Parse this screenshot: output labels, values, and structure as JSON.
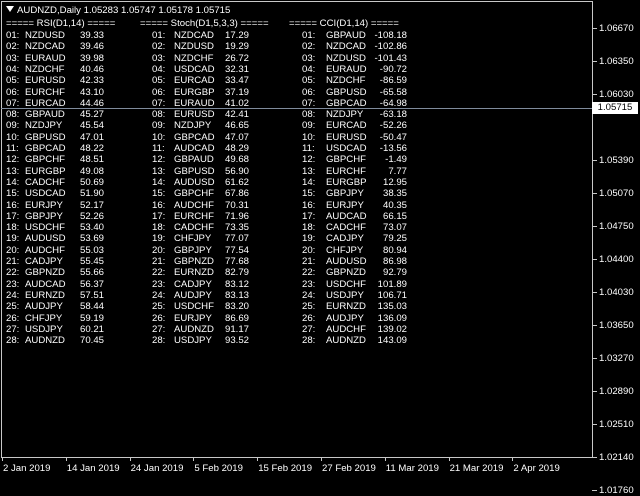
{
  "title": "AUDNZD,Daily  1.05283 1.05747 1.05178 1.05715",
  "current_price": "1.05715",
  "price_axis": [
    "1.06670",
    "1.06350",
    "1.06030",
    "1.05715",
    "1.05390",
    "1.05070",
    "1.04750",
    "1.04400",
    "1.04030",
    "1.03650",
    "1.03270",
    "1.02890",
    "1.02510",
    "1.02140",
    "1.01760"
  ],
  "time_axis": [
    "2 Jan 2019",
    "14 Jan 2019",
    "24 Jan 2019",
    "5 Feb 2019",
    "15 Feb 2019",
    "27 Feb 2019",
    "11 Mar 2019",
    "21 Mar 2019",
    "2 Apr 2019"
  ],
  "indicators": [
    {
      "header": "===== RSI(D1,14) =====",
      "rows": [
        [
          "01:",
          "NZDUSD",
          "39.33"
        ],
        [
          "02:",
          "NZDCAD",
          "39.46"
        ],
        [
          "03:",
          "EURAUD",
          "39.98"
        ],
        [
          "04:",
          "NZDCHF",
          "40.46"
        ],
        [
          "05:",
          "EURUSD",
          "42.33"
        ],
        [
          "06:",
          "EURCHF",
          "43.10"
        ],
        [
          "07:",
          "EURCAD",
          "44.46"
        ],
        [
          "08:",
          "GBPAUD",
          "45.27"
        ],
        [
          "09:",
          "NZDJPY",
          "45.54"
        ],
        [
          "10:",
          "GBPUSD",
          "47.01"
        ],
        [
          "11:",
          "GBPCAD",
          "48.22"
        ],
        [
          "12:",
          "GBPCHF",
          "48.51"
        ],
        [
          "13:",
          "EURGBP",
          "49.08"
        ],
        [
          "14:",
          "CADCHF",
          "50.69"
        ],
        [
          "15:",
          "USDCAD",
          "51.90"
        ],
        [
          "16:",
          "EURJPY",
          "52.17"
        ],
        [
          "17:",
          "GBPJPY",
          "52.26"
        ],
        [
          "18:",
          "USDCHF",
          "53.40"
        ],
        [
          "19:",
          "AUDUSD",
          "53.69"
        ],
        [
          "20:",
          "AUDCHF",
          "55.03"
        ],
        [
          "21:",
          "CADJPY",
          "55.45"
        ],
        [
          "22:",
          "GBPNZD",
          "55.66"
        ],
        [
          "23:",
          "AUDCAD",
          "56.37"
        ],
        [
          "24:",
          "EURNZD",
          "57.51"
        ],
        [
          "25:",
          "AUDJPY",
          "58.44"
        ],
        [
          "26:",
          "CHFJPY",
          "59.19"
        ],
        [
          "27:",
          "USDJPY",
          "60.21"
        ],
        [
          "28:",
          "AUDNZD",
          "70.45"
        ]
      ]
    },
    {
      "header": "===== Stoch(D1,5,3,3) =====",
      "rows": [
        [
          "01:",
          "NZDCAD",
          "17.29"
        ],
        [
          "02:",
          "NZDUSD",
          "19.29"
        ],
        [
          "03:",
          "NZDCHF",
          "26.72"
        ],
        [
          "04:",
          "USDCAD",
          "32.31"
        ],
        [
          "05:",
          "EURCAD",
          "33.47"
        ],
        [
          "06:",
          "EURGBP",
          "37.19"
        ],
        [
          "07:",
          "EURAUD",
          "41.02"
        ],
        [
          "08:",
          "EURUSD",
          "42.41"
        ],
        [
          "09:",
          "NZDJPY",
          "46.65"
        ],
        [
          "10:",
          "GBPCAD",
          "47.07"
        ],
        [
          "11:",
          "AUDCAD",
          "48.29"
        ],
        [
          "12:",
          "GBPAUD",
          "49.68"
        ],
        [
          "13:",
          "GBPUSD",
          "56.90"
        ],
        [
          "14:",
          "AUDUSD",
          "61.62"
        ],
        [
          "15:",
          "GBPCHF",
          "67.86"
        ],
        [
          "16:",
          "AUDCHF",
          "70.31"
        ],
        [
          "17:",
          "EURCHF",
          "71.96"
        ],
        [
          "18:",
          "CADCHF",
          "73.35"
        ],
        [
          "19:",
          "CHFJPY",
          "77.07"
        ],
        [
          "20:",
          "GBPJPY",
          "77.54"
        ],
        [
          "21:",
          "GBPNZD",
          "77.68"
        ],
        [
          "22:",
          "EURNZD",
          "82.79"
        ],
        [
          "23:",
          "CADJPY",
          "83.12"
        ],
        [
          "24:",
          "AUDJPY",
          "83.13"
        ],
        [
          "25:",
          "USDCHF",
          "83.20"
        ],
        [
          "26:",
          "EURJPY",
          "86.69"
        ],
        [
          "27:",
          "AUDNZD",
          "91.17"
        ],
        [
          "28:",
          "USDJPY",
          "93.52"
        ]
      ]
    },
    {
      "header": "===== CCI(D1,14) =====",
      "rows": [
        [
          "01:",
          "GBPAUD",
          "-108.18"
        ],
        [
          "02:",
          "NZDCAD",
          "-102.86"
        ],
        [
          "03:",
          "NZDUSD",
          "-101.43"
        ],
        [
          "04:",
          "EURAUD",
          "-90.72"
        ],
        [
          "05:",
          "NZDCHF",
          "-86.59"
        ],
        [
          "06:",
          "GBPUSD",
          "-65.58"
        ],
        [
          "07:",
          "GBPCAD",
          "-64.98"
        ],
        [
          "08:",
          "NZDJPY",
          "-63.18"
        ],
        [
          "09:",
          "EURCAD",
          "-52.26"
        ],
        [
          "10:",
          "EURUSD",
          "-50.47"
        ],
        [
          "11:",
          "USDCAD",
          "-13.56"
        ],
        [
          "12:",
          "GBPCHF",
          "-1.49"
        ],
        [
          "13:",
          "EURCHF",
          "7.77"
        ],
        [
          "14:",
          "EURGBP",
          "12.95"
        ],
        [
          "15:",
          "GBPJPY",
          "38.35"
        ],
        [
          "16:",
          "EURJPY",
          "40.35"
        ],
        [
          "17:",
          "AUDCAD",
          "66.15"
        ],
        [
          "18:",
          "CADCHF",
          "73.07"
        ],
        [
          "19:",
          "CADJPY",
          "79.25"
        ],
        [
          "20:",
          "CHFJPY",
          "80.94"
        ],
        [
          "21:",
          "AUDUSD",
          "86.98"
        ],
        [
          "22:",
          "GBPNZD",
          "92.79"
        ],
        [
          "23:",
          "USDCHF",
          "101.89"
        ],
        [
          "24:",
          "USDJPY",
          "106.71"
        ],
        [
          "25:",
          "EURNZD",
          "135.03"
        ],
        [
          "26:",
          "AUDJPY",
          "136.09"
        ],
        [
          "27:",
          "AUDCHF",
          "139.02"
        ],
        [
          "28:",
          "AUDNZD",
          "143.09"
        ]
      ]
    }
  ]
}
